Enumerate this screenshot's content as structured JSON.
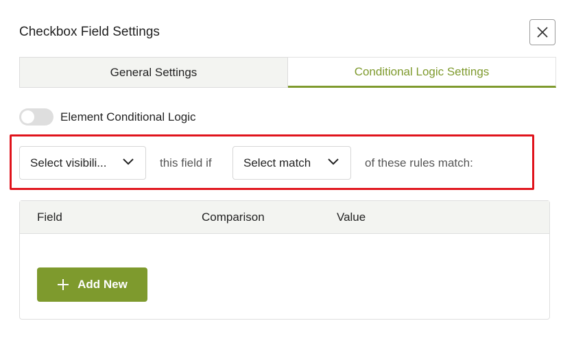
{
  "dialog": {
    "title": "Checkbox Field Settings"
  },
  "icons": {
    "close": "close-icon",
    "chevron": "chevron-down-icon",
    "plus": "plus-icon"
  },
  "tabs": [
    {
      "label": "General Settings",
      "active": false
    },
    {
      "label": "Conditional Logic Settings",
      "active": true
    }
  ],
  "conditional": {
    "toggle_label": "Element Conditional Logic",
    "toggle_on": false,
    "visibility_select": "Select visibili...",
    "text_middle": "this field if",
    "match_select": "Select match",
    "text_end": "of these rules match:"
  },
  "rules": {
    "columns": [
      "Field",
      "Comparison",
      "Value"
    ],
    "add_button": "Add New"
  },
  "colors": {
    "accent": "#7e9a2d",
    "highlight": "#e0131b"
  }
}
